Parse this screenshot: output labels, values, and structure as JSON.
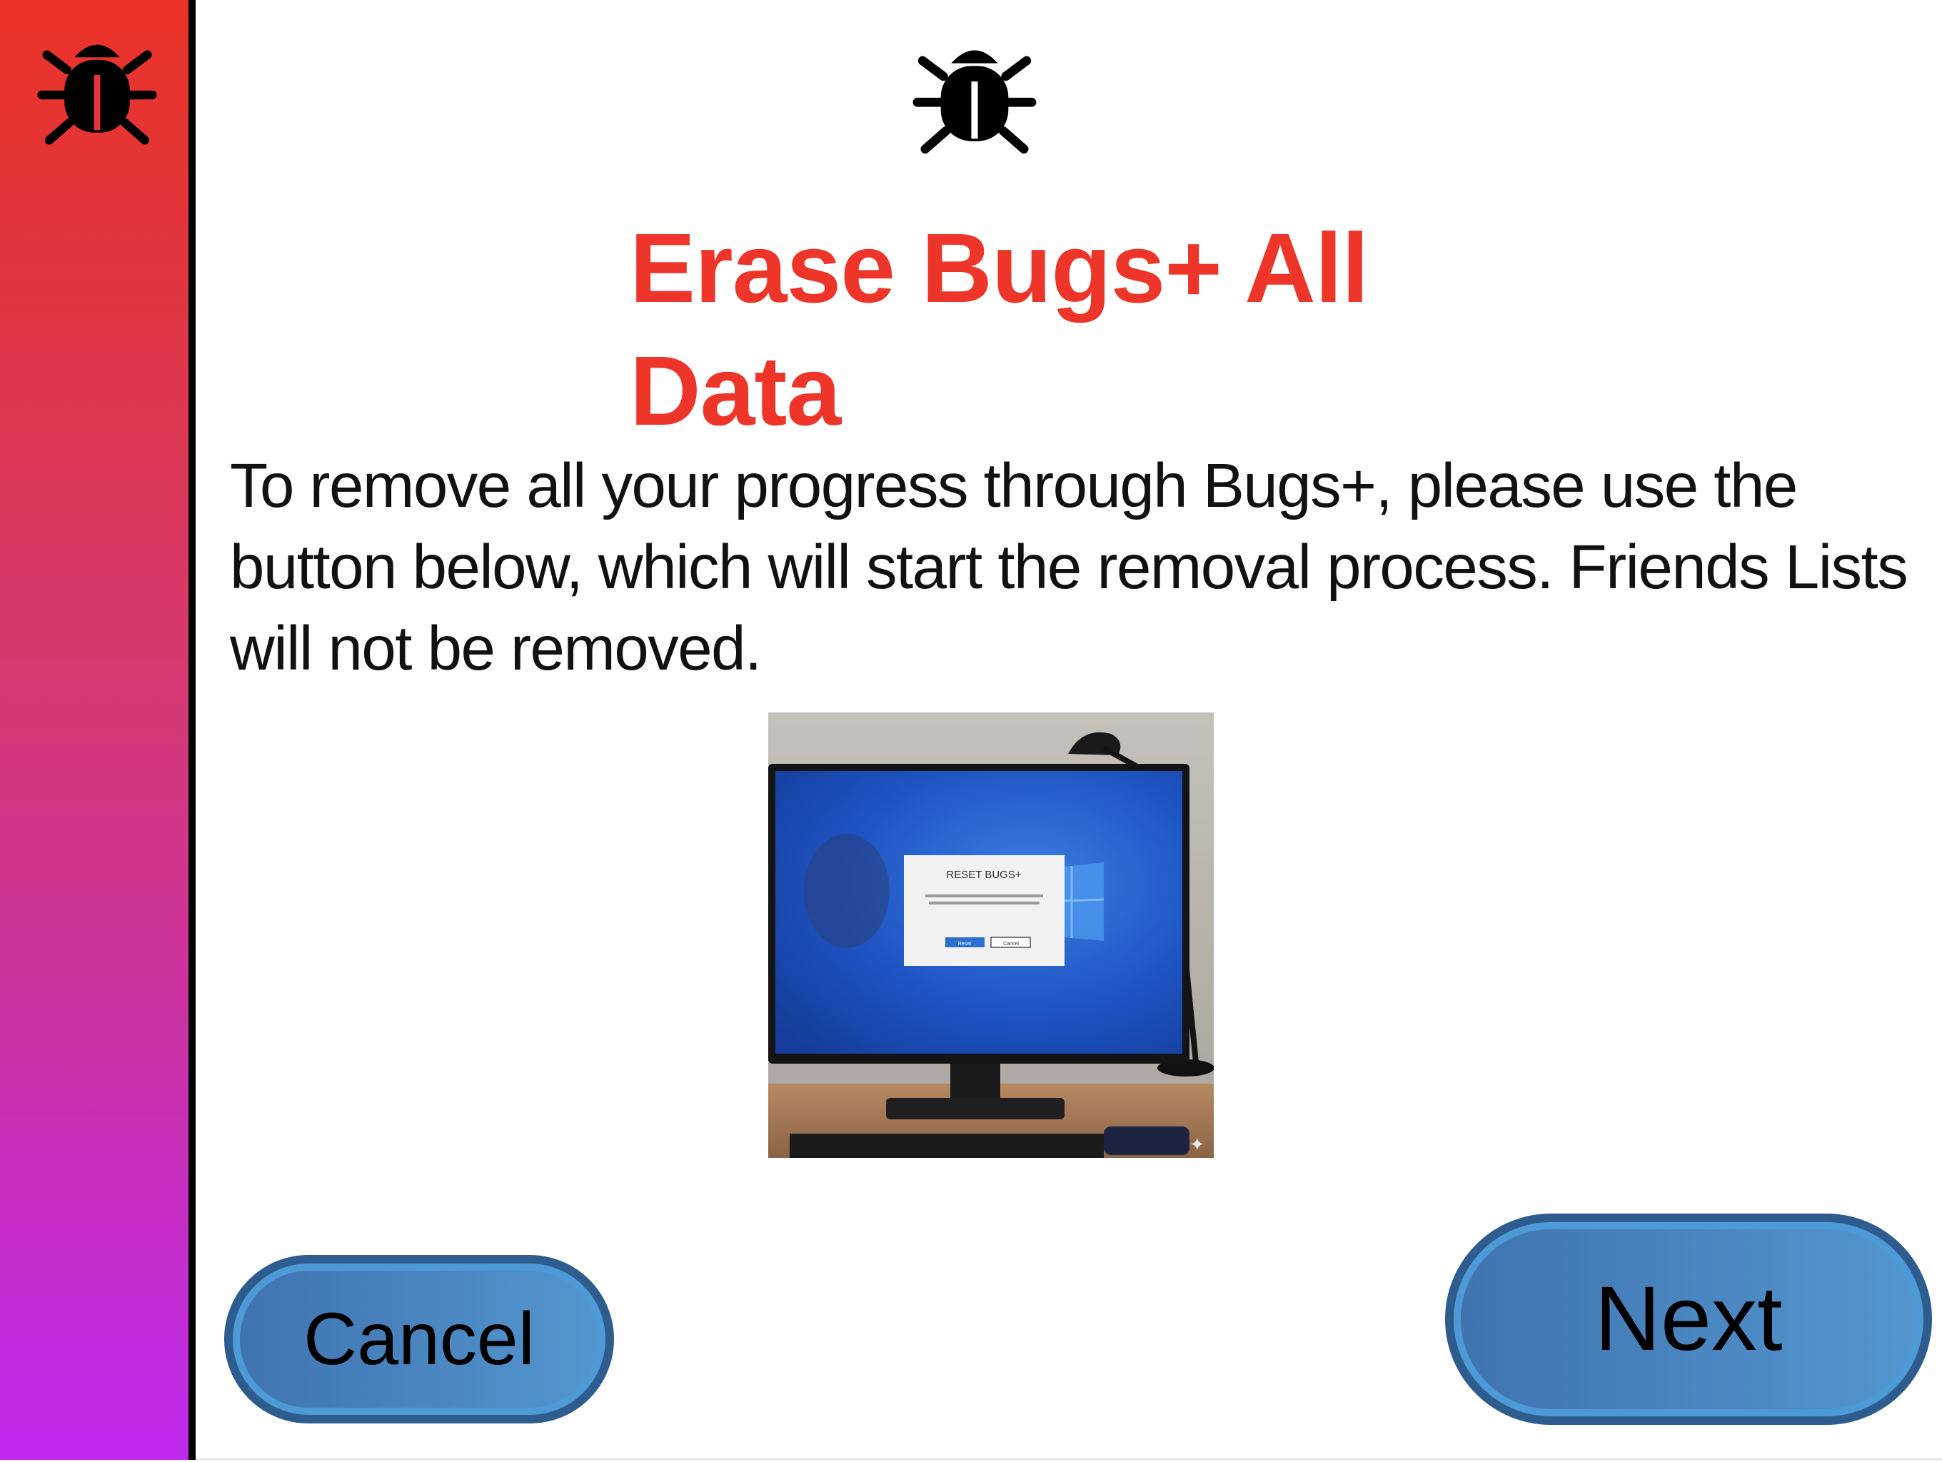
{
  "sidebar": {
    "icon": "bug-icon",
    "gradient_top": "#ea3327",
    "gradient_bottom": "#bf2af0"
  },
  "header": {
    "icon": "bug-icon",
    "title": "Erase Bugs+ All Data",
    "title_color": "#ee3529"
  },
  "main": {
    "description": "To remove all your progress through Bugs+, please use the button below, which will start the removal process. Friends Lists will not be removed.",
    "illustration": {
      "dialog_title": "RESET BUGS+",
      "dialog_primary": "Reset",
      "dialog_secondary": "Cancel"
    }
  },
  "buttons": {
    "cancel_label": "Cancel",
    "next_label": "Next",
    "color": "#4a86c2"
  }
}
